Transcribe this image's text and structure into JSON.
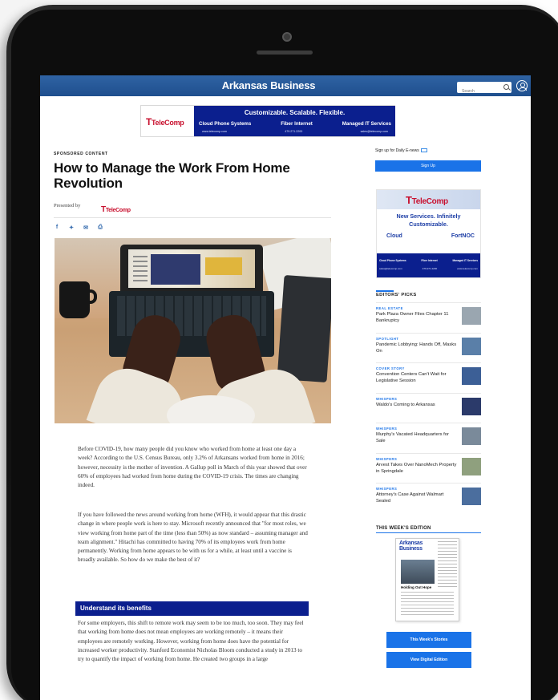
{
  "site": {
    "brand": "Arkansas Business",
    "search_placeholder": "Search"
  },
  "top_ad": {
    "logo": "TeleComp",
    "headline": "Customizable. Scalable. Flexible.",
    "services": [
      "Cloud Phone Systems",
      "Fiber Internet",
      "Managed IT Services"
    ],
    "contacts": [
      "www.telecomp.com",
      "479.271.2200",
      "sales@telecomp.com"
    ]
  },
  "article": {
    "kicker": "SPONSORED CONTENT",
    "title": "How to Manage the Work From Home Revolution",
    "presented_by": "Presented by",
    "presenter_logo": "TeleComp",
    "share_icons": [
      "facebook-icon",
      "twitter-icon",
      "mail-icon",
      "print-icon"
    ],
    "paragraphs": [
      "Before COVID-19, how many people did you know who worked from home at least one day a week? According to the U.S. Census Bureau, only 3.2% of Arkansans worked from home in 2016; however, necessity is the mother of invention. A Gallup poll in March of this year showed that over 60% of employees had worked from home during the COVID-19 crisis. The times are changing indeed.",
      "If you have followed the news around working from home (WFH), it would appear that this drastic change in where people work is here to stay. Microsoft recently announced that \"for most roles, we view working from home part of the time (less than 50%) as now standard – assuming manager and team alignment.\" Hitachi has committed to having 70% of its employees work from home permanently. Working from home appears to be with us for a while, at least until a vaccine is broadly available. So how do we make the best of it?"
    ],
    "section_heading": "Understand its benefits",
    "section_paragraph": "For some employers, this shift to remote work may seem to be too much, too soon. They may feel that working from home does not mean employees are working remotely – it means their employees are remotely working. However, working from home does have the potential for increased worker productivity. Stanford Economist Nicholas Bloom conducted a study in 2013 to try to quantify the impact of working from home. He created two groups in a large"
  },
  "sidebar": {
    "signup_label": "Sign up for Daily E-news",
    "signup_button": "Sign Up",
    "ad": {
      "logo": "TeleComp",
      "headline": "New Services. Infinitely Customizable.",
      "brands": [
        "Cloud",
        "FortNOC"
      ],
      "services": [
        "Cloud Phone Systems",
        "Fiber Internet",
        "Managed IT Services"
      ],
      "contacts": [
        "sales@telecomp.com",
        "479.271.2200",
        "www.telecomp.com"
      ]
    },
    "editors_picks_title": "EDITORS' PICKS",
    "picks": [
      {
        "category": "REAL ESTATE",
        "title": "Park Plaza Owner Files Chapter 11 Bankruptcy",
        "thumb_color": "#9aa6b0"
      },
      {
        "category": "SPOTLIGHT",
        "title": "Pandemic Lobbying: Hands Off, Masks On",
        "thumb_color": "#5a7fa8"
      },
      {
        "category": "COVER STORY",
        "title": "Convention Centers Can't Wait for Legislative Session",
        "thumb_color": "#3c5f96"
      },
      {
        "category": "WHISPERS",
        "title": "Waldo's Coming to Arkansas",
        "thumb_color": "#2b3a6a"
      },
      {
        "category": "WHISPERS",
        "title": "Murphy's Vacated Headquarters for Sale",
        "thumb_color": "#7a8a9a"
      },
      {
        "category": "WHISPERS",
        "title": "Arvest Takes Over NanoMech Property in Springdale",
        "thumb_color": "#8fa07e"
      },
      {
        "category": "WHISPERS",
        "title": "Attorney's Case Against Walmart Sealed",
        "thumb_color": "#4b6e9e"
      }
    ],
    "edition_title": "THIS WEEK'S EDITION",
    "magazine": {
      "title": "Arkansas Business",
      "headline": "Holding Out Hope"
    },
    "stories_button": "This Week's Stories",
    "digital_button": "View Digital Edition"
  },
  "colors": {
    "brand_blue": "#1f4f8e",
    "accent_blue": "#1a73e8",
    "ad_navy": "#0b1f8e",
    "telecomp_red": "#c8102e"
  }
}
